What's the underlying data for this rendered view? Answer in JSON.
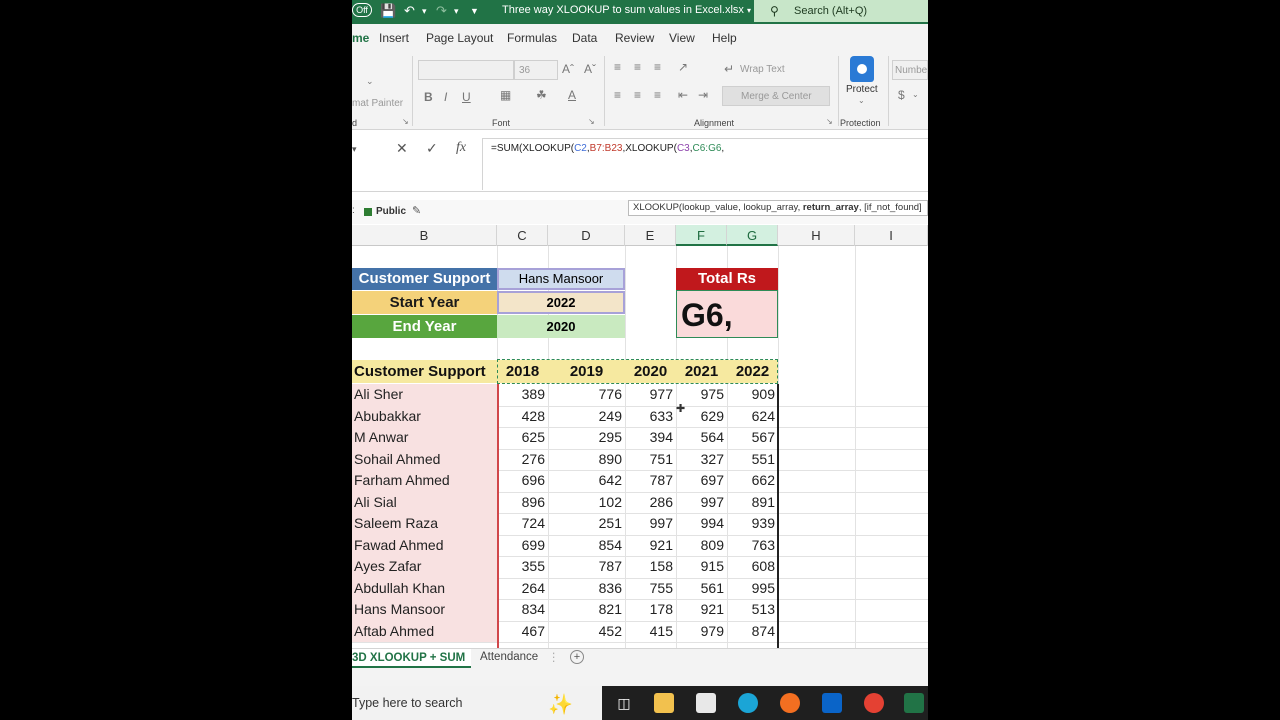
{
  "titlebar": {
    "autosave_label": "Off",
    "title": "Three way XLOOKUP to sum values in Excel.xlsx",
    "search_placeholder": "Search (Alt+Q)"
  },
  "tabs": [
    "me",
    "Insert",
    "Page Layout",
    "Formulas",
    "Data",
    "Review",
    "View",
    "Help"
  ],
  "ribbon": {
    "format_painter": "mat Painter",
    "font_size": "36",
    "wrap_text": "Wrap Text",
    "merge_center": "Merge & Center",
    "protect": "Protect",
    "number": "Numbe",
    "group_font": "Font",
    "group_alignment": "Alignment",
    "group_protection": "Protection",
    "group_clipboard": "d"
  },
  "formula_bar": {
    "fn_prefix": "=SUM(XLOOKUP(",
    "ref1": "C2",
    "comma1": ",",
    "ref2": "B7:B23",
    "mid": ",XLOOKUP(",
    "ref3": "C3",
    "comma2": ",",
    "ref4": "C6:G6",
    "tail": ","
  },
  "sensitivity": {
    "label": "Public"
  },
  "tooltip": {
    "prefix": "XLOOKUP(lookup_value, lookup_array, ",
    "bold": "return_array",
    "suffix": ", [if_not_found]"
  },
  "columns": [
    "B",
    "C",
    "D",
    "E",
    "F",
    "G",
    "H",
    "I"
  ],
  "inputs": {
    "cs_label": "Customer Support",
    "cs_value": "Hans Mansoor",
    "sy_label": "Start Year",
    "sy_value": "2022",
    "ey_label": "End Year",
    "ey_value": "2020",
    "total_label": "Total Rs",
    "total_value": "G6,"
  },
  "table": {
    "header": [
      "Customer Support",
      "2018",
      "2019",
      "2020",
      "2021",
      "2022"
    ],
    "rows": [
      [
        "Ali Sher",
        "389",
        "776",
        "977",
        "975",
        "909"
      ],
      [
        "Abubakkar",
        "428",
        "249",
        "633",
        "629",
        "624"
      ],
      [
        "M Anwar",
        "625",
        "295",
        "394",
        "564",
        "567"
      ],
      [
        "Sohail Ahmed",
        "276",
        "890",
        "751",
        "327",
        "551"
      ],
      [
        "Farham Ahmed",
        "696",
        "642",
        "787",
        "697",
        "662"
      ],
      [
        "Ali Sial",
        "896",
        "102",
        "286",
        "997",
        "891"
      ],
      [
        "Saleem Raza",
        "724",
        "251",
        "997",
        "994",
        "939"
      ],
      [
        "Fawad Ahmed",
        "699",
        "854",
        "921",
        "809",
        "763"
      ],
      [
        "Ayes Zafar",
        "355",
        "787",
        "158",
        "915",
        "608"
      ],
      [
        "Abdullah Khan",
        "264",
        "836",
        "755",
        "561",
        "995"
      ],
      [
        "Hans Mansoor",
        "834",
        "821",
        "178",
        "921",
        "513"
      ],
      [
        "Aftab Ahmed",
        "467",
        "452",
        "415",
        "979",
        "874"
      ]
    ]
  },
  "sheet_tabs": {
    "active": "3D XLOOKUP + SUM",
    "other": "Attendance"
  },
  "taskbar": {
    "search_placeholder": "Type here to search"
  },
  "colors": {
    "excel_green": "#217346",
    "label_blue": "#4472a8",
    "label_yellow": "#f4d27a",
    "label_green": "#58a63e",
    "total_red": "#c0181c",
    "header_yellow": "#f6e9a0",
    "name_pink": "#f8e1e1"
  }
}
